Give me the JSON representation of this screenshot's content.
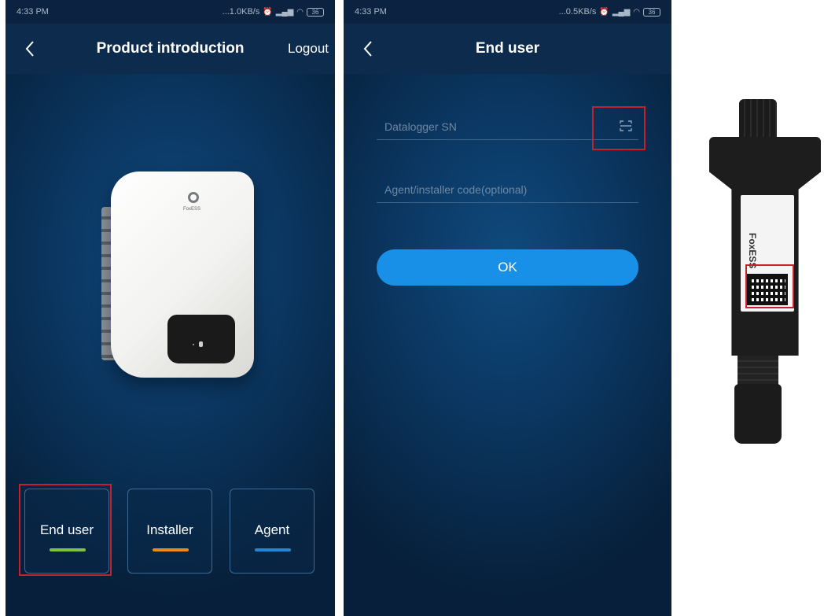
{
  "screen1": {
    "status": {
      "time": "4:33 PM",
      "speed": "...1.0KB/s",
      "battery": "36"
    },
    "nav": {
      "title": "Product introduction",
      "logout": "Logout"
    },
    "product_brand": "FoxESS",
    "roles": [
      {
        "label": "End user",
        "bar_color": "#7dc241"
      },
      {
        "label": "Installer",
        "bar_color": "#e98a1b"
      },
      {
        "label": "Agent",
        "bar_color": "#1e88d8"
      }
    ]
  },
  "screen2": {
    "status": {
      "time": "4:33 PM",
      "speed": "...0.5KB/s",
      "battery": "36"
    },
    "nav": {
      "title": "End user"
    },
    "datalogger_field": {
      "placeholder": "Datalogger SN"
    },
    "code_field": {
      "placeholder": "Agent/installer code(optional)"
    },
    "ok_label": "OK"
  },
  "datalogger": {
    "brand": "FoxESS"
  },
  "icons": {
    "back": "chevron-left-icon",
    "scan": "scan-icon",
    "wifi": "wifi-icon",
    "signal": "signal-icon",
    "alarm": "alarm-icon"
  },
  "colors": {
    "accent": "#1890e8",
    "highlight": "#c8202a",
    "background": "#0b3762"
  }
}
